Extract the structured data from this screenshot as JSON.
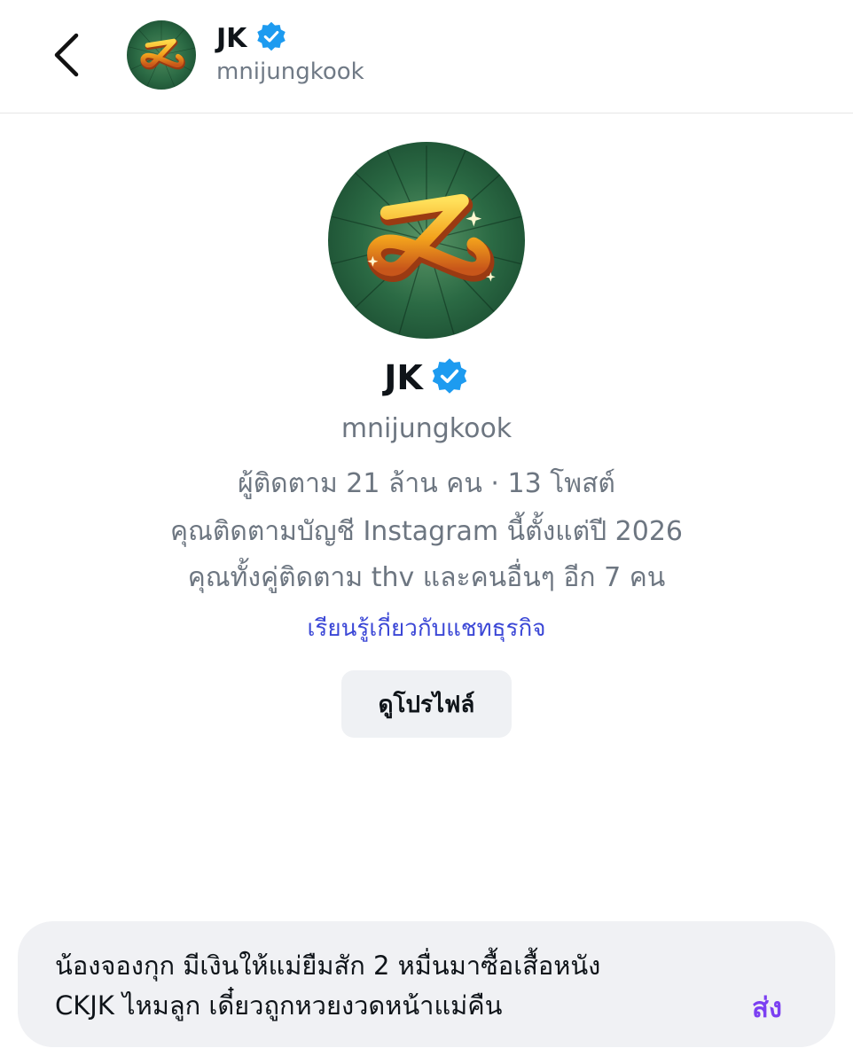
{
  "header": {
    "name": "JK",
    "username": "mnijungkook"
  },
  "profile": {
    "name": "JK",
    "username": "mnijungkook",
    "stats": "ผู้ติดตาม 21 ล้าน คน · 13 โพสต์",
    "following_since": "คุณติดตามบัญชี Instagram นี้ตั้งแต่ปี 2026",
    "mutual": "คุณทั้งคู่ติดตาม thv และคนอื่นๆ อีก 7 คน",
    "business_link": "เรียนรู้เกี่ยวกับแชทธุรกิจ",
    "view_profile_label": "ดูโปรไฟล์"
  },
  "composer": {
    "message_line1": "น้องจองกุก มีเงินให้แม่ยืมสัก 2 หมื่นมาซื้อเสื้อหนัง",
    "message_line2": "CKJK ไหมลูก เดี๋ยวถูกหวยงวดหน้าแม่คืน",
    "send_label": "ส่ง"
  },
  "colors": {
    "verified": "#1d9bf0",
    "link": "#3b47d6",
    "send": "#7b3ff2",
    "avatar_bg": "#1f5a3a",
    "avatar_logo": "#f3b21c"
  },
  "icons": {
    "back": "chevron-left-icon",
    "verified": "verified-badge-icon",
    "avatar_logo": "infinity-logo-icon"
  }
}
